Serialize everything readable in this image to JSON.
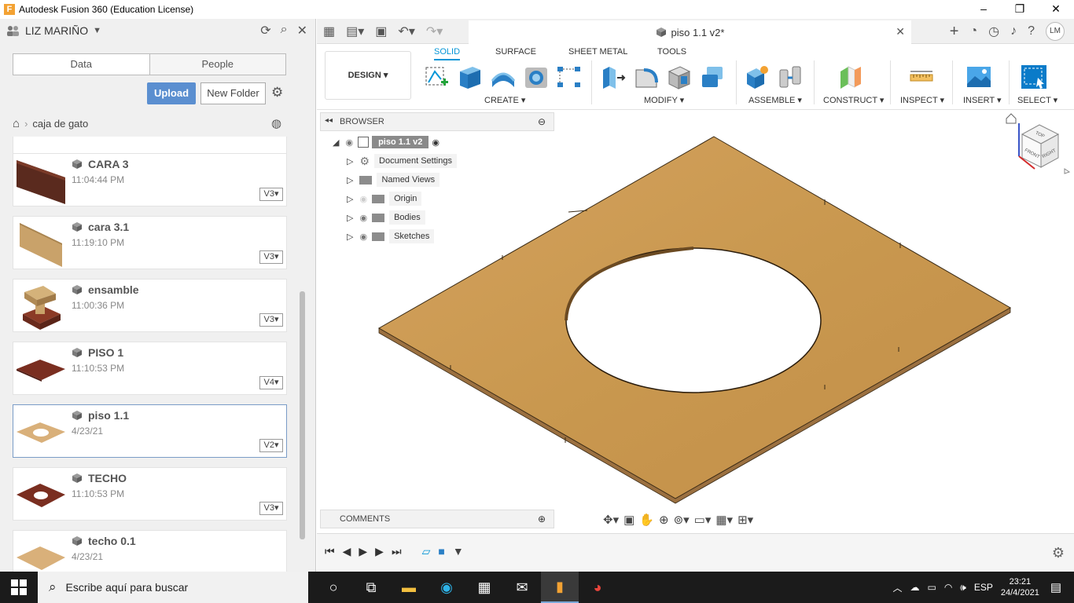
{
  "window": {
    "title": "Autodesk Fusion 360 (Education License)",
    "logo_letter": "F",
    "min": "–",
    "max": "❐",
    "close": "✕"
  },
  "left_panel": {
    "user": "LIZ MARIÑO",
    "tabs": [
      "Data",
      "People"
    ],
    "upload_label": "Upload",
    "new_folder_label": "New Folder",
    "breadcrumb_folder": "caja de gato",
    "files": [
      {
        "name": "CARA 3",
        "time": "11:04:44 PM",
        "version": "V3"
      },
      {
        "name": "cara 3.1",
        "time": "11:19:10 PM",
        "version": "V3"
      },
      {
        "name": "ensamble",
        "time": "11:00:36 PM",
        "version": "V3"
      },
      {
        "name": "PISO 1",
        "time": "11:10:53 PM",
        "version": "V4"
      },
      {
        "name": "piso 1.1",
        "time": "4/23/21",
        "version": "V2"
      },
      {
        "name": "TECHO",
        "time": "11:10:53 PM",
        "version": "V3"
      },
      {
        "name": "techo 0.1",
        "time": "4/23/21",
        "version": ""
      }
    ]
  },
  "doc": {
    "tab_title": "piso 1.1 v2*",
    "avatar": "LM"
  },
  "toolbar": {
    "workspace": "DESIGN",
    "tabs": [
      "SOLID",
      "SURFACE",
      "SHEET METAL",
      "TOOLS"
    ],
    "groups": [
      "CREATE",
      "MODIFY",
      "ASSEMBLE",
      "CONSTRUCT",
      "INSPECT",
      "INSERT",
      "SELECT"
    ]
  },
  "browser": {
    "title": "BROWSER",
    "root": "piso 1.1 v2",
    "items": [
      "Document Settings",
      "Named Views",
      "Origin",
      "Bodies",
      "Sketches"
    ]
  },
  "comments_title": "COMMENTS",
  "viewcube": {
    "top": "TOP",
    "front": "FRONT",
    "right": "RIGHT"
  },
  "taskbar": {
    "search_placeholder": "Escribe aquí para buscar",
    "lang": "ESP",
    "time": "23:21",
    "date": "24/4/2021"
  },
  "colors": {
    "accent": "#0696d7",
    "wood": "#c99a55",
    "upload": "#5b8fd0"
  }
}
